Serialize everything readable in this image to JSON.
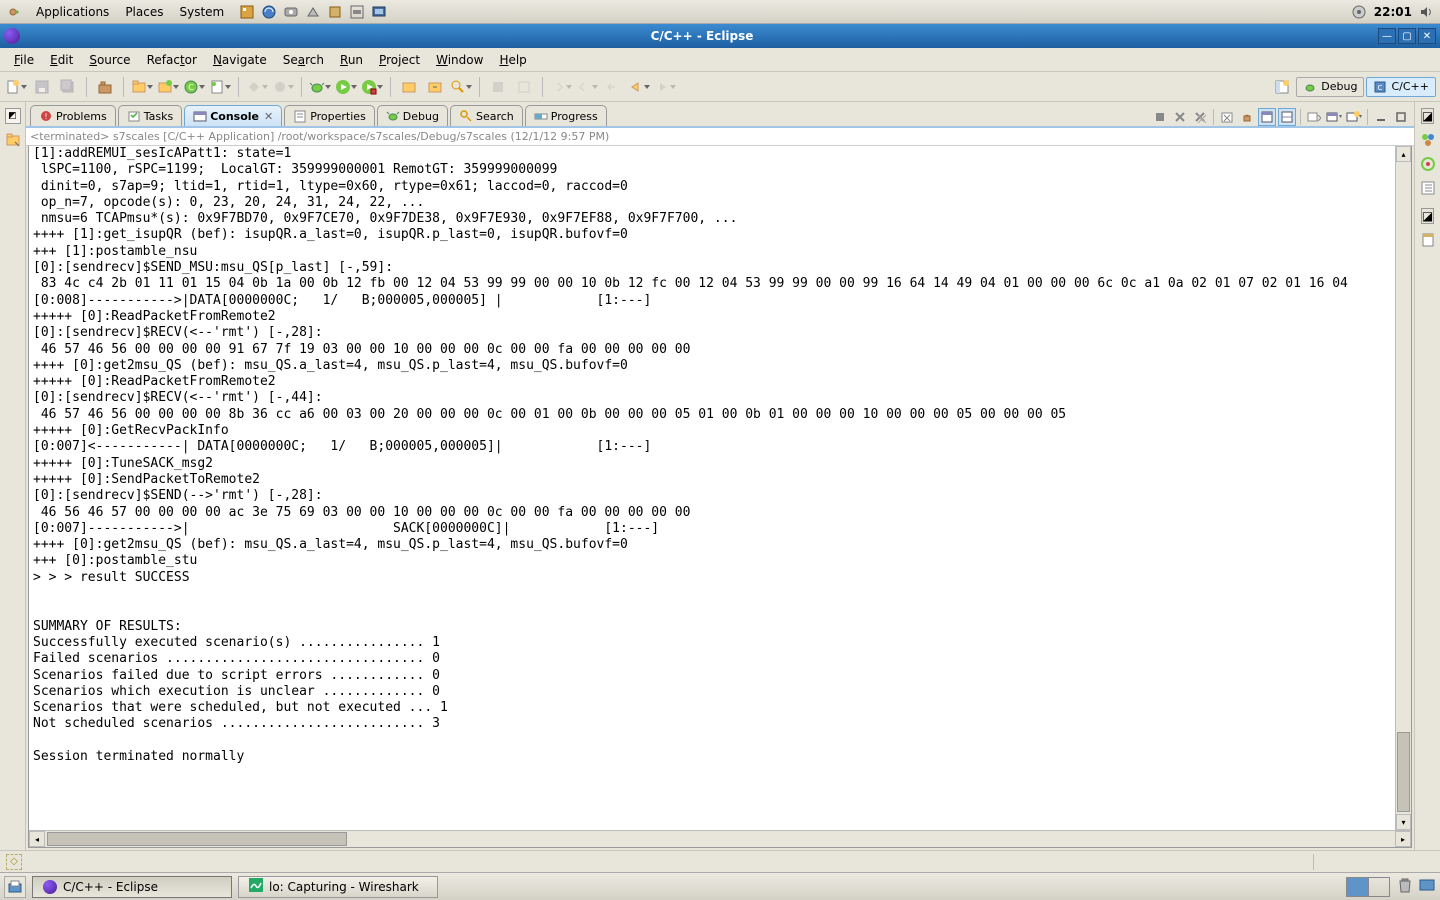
{
  "gnome": {
    "menus": [
      "Applications",
      "Places",
      "System"
    ],
    "clock": "22:01"
  },
  "titlebar": {
    "title": "C/C++ - Eclipse"
  },
  "menubar": [
    "File",
    "Edit",
    "Source",
    "Refactor",
    "Navigate",
    "Search",
    "Run",
    "Project",
    "Window",
    "Help"
  ],
  "perspectives": {
    "debug": "Debug",
    "cpp": "C/C++"
  },
  "tabs": [
    {
      "label": "Problems",
      "active": false
    },
    {
      "label": "Tasks",
      "active": false
    },
    {
      "label": "Console",
      "active": true,
      "closable": true
    },
    {
      "label": "Properties",
      "active": false
    },
    {
      "label": "Debug",
      "active": false
    },
    {
      "label": "Search",
      "active": false
    },
    {
      "label": "Progress",
      "active": false
    }
  ],
  "console": {
    "header": "<terminated> s7scales [C/C++ Application] /root/workspace/s7scales/Debug/s7scales (12/1/12 9:57 PM)",
    "text": "[1]:addREMUI_sesIcAPatt1: state=1\n lSPC=1100, rSPC=1199;  LocalGT: 359999000001 RemotGT: 359999000099\n dinit=0, s7ap=9; ltid=1, rtid=1, ltype=0x60, rtype=0x61; laccod=0, raccod=0\n op_n=7, opcode(s): 0, 23, 20, 24, 31, 24, 22, ...\n nmsu=6 TCAPmsu*(s): 0x9F7BD70, 0x9F7CE70, 0x9F7DE38, 0x9F7E930, 0x9F7EF88, 0x9F7F700, ...\n++++ [1]:get_isupQR (bef): isupQR.a_last=0, isupQR.p_last=0, isupQR.bufovf=0\n+++ [1]:postamble_nsu\n[0]:[sendrecv]$SEND_MSU:msu_QS[p_last] [-,59]:\n 83 4c c4 2b 01 11 01 15 04 0b 1a 00 0b 12 fb 00 12 04 53 99 99 00 00 10 0b 12 fc 00 12 04 53 99 99 00 00 99 16 64 14 49 04 01 00 00 00 6c 0c a1 0a 02 01 07 02 01 16 04\n[0:008]----------->|DATA[0000000C;   1/   B;000005,000005] |            [1:---]\n+++++ [0]:ReadPacketFromRemote2\n[0]:[sendrecv]$RECV(<--'rmt') [-,28]:\n 46 57 46 56 00 00 00 00 91 67 7f 19 03 00 00 10 00 00 00 0c 00 00 fa 00 00 00 00 00\n++++ [0]:get2msu_QS (bef): msu_QS.a_last=4, msu_QS.p_last=4, msu_QS.bufovf=0\n+++++ [0]:ReadPacketFromRemote2\n[0]:[sendrecv]$RECV(<--'rmt') [-,44]:\n 46 57 46 56 00 00 00 00 8b 36 cc a6 00 03 00 20 00 00 00 0c 00 01 00 0b 00 00 00 05 01 00 0b 01 00 00 00 10 00 00 00 05 00 00 00 05\n+++++ [0]:GetRecvPackInfo\n[0:007]<-----------| DATA[0000000C;   1/   B;000005,000005]|            [1:---]\n+++++ [0]:TuneSACK_msg2\n+++++ [0]:SendPacketToRemote2\n[0]:[sendrecv]$SEND(-->'rmt') [-,28]:\n 46 56 46 57 00 00 00 00 ac 3e 75 69 03 00 00 10 00 00 00 0c 00 00 fa 00 00 00 00 00\n[0:007]----------->|                          SACK[0000000C]|            [1:---]\n++++ [0]:get2msu_QS (bef): msu_QS.a_last=4, msu_QS.p_last=4, msu_QS.bufovf=0\n+++ [0]:postamble_stu\n> > > result SUCCESS\n\n\nSUMMARY OF RESULTS:\nSuccessfully executed scenario(s) ................ 1\nFailed scenarios ................................. 0\nScenarios failed due to script errors ............ 0\nScenarios which execution is unclear ............. 0\nScenarios that were scheduled, but not executed ... 1\nNot scheduled scenarios .......................... 3\n\nSession terminated normally\n"
  },
  "taskbar": {
    "tasks": [
      {
        "label": "C/C++ - Eclipse",
        "active": true,
        "icon": "eclipse"
      },
      {
        "label": "lo: Capturing - Wireshark",
        "active": false,
        "icon": "wireshark"
      }
    ]
  }
}
